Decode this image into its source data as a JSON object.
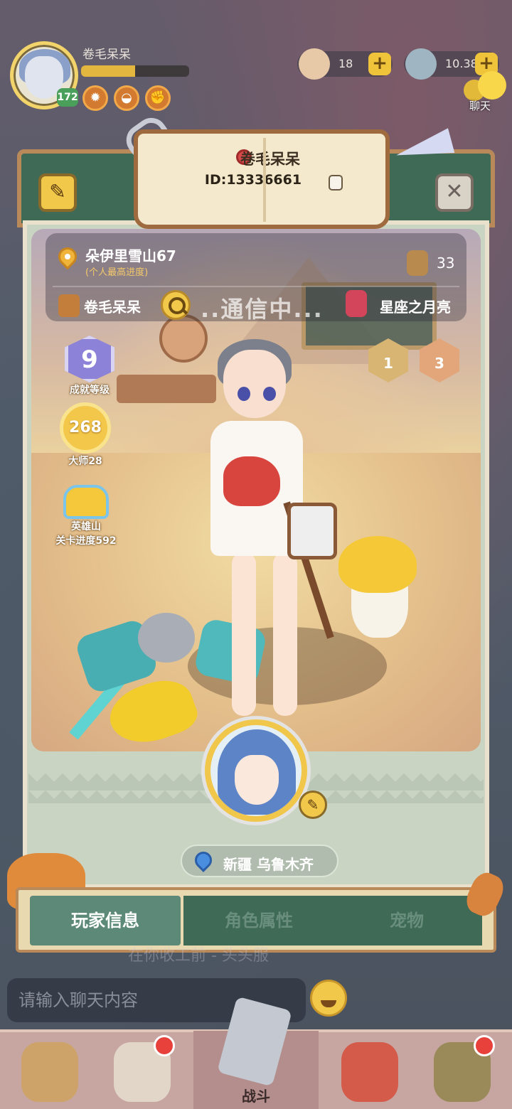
{
  "hud": {
    "player_name": "卷毛呆呆",
    "level": "172",
    "xp_progress": 0.5,
    "currency_gems": "18",
    "currency_coins": "10.38M",
    "chat_label": "聊天"
  },
  "profile": {
    "name": "卷毛呆呆",
    "id_text": "ID:13336661",
    "location": "朵伊里雪山67",
    "location_sub": "(个人最高进度)",
    "likes": "33",
    "guild_name": "卷毛呆呆",
    "comm_status": "..通信中...",
    "zodiac": "星座之月亮",
    "region": "新疆 乌鲁木齐"
  },
  "stats": {
    "achievement_level": "9",
    "achievement_label": "成就等级",
    "master_value": "268",
    "master_label": "大师28",
    "hero_label_1": "英雄山",
    "hero_label_2": "关卡进度592",
    "medal_1": "1",
    "medal_2": "3"
  },
  "tabs": [
    {
      "label": "玩家信息",
      "active": true
    },
    {
      "label": "角色属性",
      "active": false
    },
    {
      "label": "宠物",
      "active": false
    }
  ],
  "chat": {
    "placeholder": "请输入聊天内容",
    "bg_text": "在你收工前 - 头头服"
  },
  "nav": {
    "battle_label": "战斗"
  },
  "colors": {
    "gold": "#f2c84a",
    "board_green": "#3f6a56",
    "tab_active": "#5d8a78"
  }
}
